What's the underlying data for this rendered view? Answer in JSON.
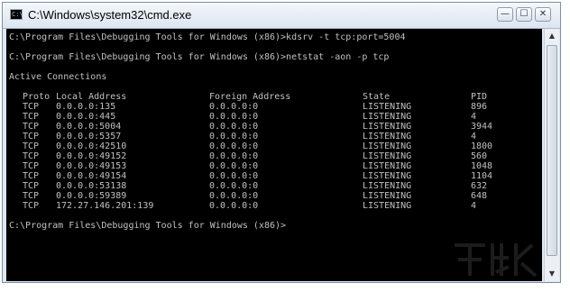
{
  "window": {
    "title": "C:\\Windows\\system32\\cmd.exe",
    "icon": "cmd-icon",
    "controls": {
      "minimize": "—",
      "maximize": "☐",
      "close": "✕"
    }
  },
  "console": {
    "lines_before": [
      "C:\\Program Files\\Debugging Tools for Windows (x86)>kdsrv -t tcp:port=5004",
      "",
      "C:\\Program Files\\Debugging Tools for Windows (x86)>netstat -aon -p tcp",
      "",
      "Active Connections",
      ""
    ],
    "table": {
      "headers": [
        "Proto",
        "Local Address",
        "Foreign Address",
        "State",
        "PID"
      ],
      "rows": [
        [
          "TCP",
          "0.0.0.0:135",
          "0.0.0.0:0",
          "LISTENING",
          "896"
        ],
        [
          "TCP",
          "0.0.0.0:445",
          "0.0.0.0:0",
          "LISTENING",
          "4"
        ],
        [
          "TCP",
          "0.0.0.0:5004",
          "0.0.0.0:0",
          "LISTENING",
          "3944"
        ],
        [
          "TCP",
          "0.0.0.0:5357",
          "0.0.0.0:0",
          "LISTENING",
          "4"
        ],
        [
          "TCP",
          "0.0.0.0:42510",
          "0.0.0.0:0",
          "LISTENING",
          "1800"
        ],
        [
          "TCP",
          "0.0.0.0:49152",
          "0.0.0.0:0",
          "LISTENING",
          "560"
        ],
        [
          "TCP",
          "0.0.0.0:49153",
          "0.0.0.0:0",
          "LISTENING",
          "1048"
        ],
        [
          "TCP",
          "0.0.0.0:49154",
          "0.0.0.0:0",
          "LISTENING",
          "1104"
        ],
        [
          "TCP",
          "0.0.0.0:53138",
          "0.0.0.0:0",
          "LISTENING",
          "632"
        ],
        [
          "TCP",
          "0.0.0.0:59389",
          "0.0.0.0:0",
          "LISTENING",
          "648"
        ],
        [
          "TCP",
          "172.27.146.201:139",
          "0.0.0.0:0",
          "LISTENING",
          "4"
        ]
      ]
    },
    "prompt": "C:\\Program Files\\Debugging Tools for Windows (x86)>"
  },
  "scrollbar": {
    "up_icon": "▲",
    "down_icon": "▼"
  },
  "colors": {
    "console_bg": "#000000",
    "console_fg": "#c0c0c0"
  }
}
